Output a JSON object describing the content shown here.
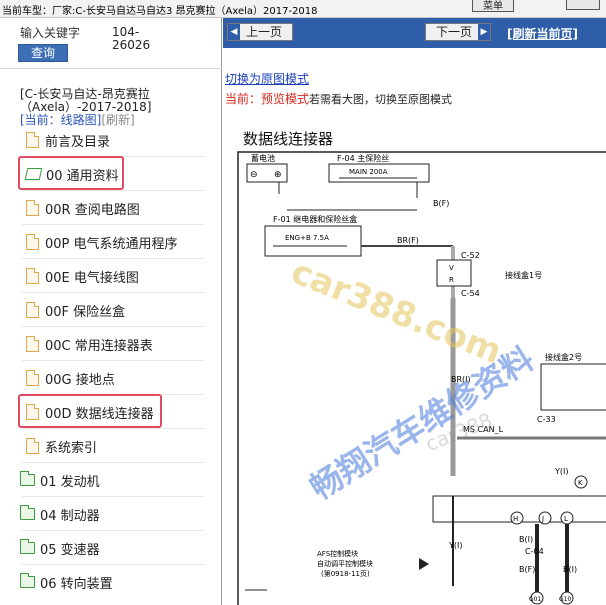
{
  "topbar": {
    "vehicle_label": "当前车型：",
    "vehicle_value": "厂家:C-长安马自达马自达3 昂克赛拉（Axela）2017-2018",
    "menu_label": "菜单"
  },
  "search": {
    "placeholder": "输入关键字",
    "button": "查询",
    "code_line1": "104-",
    "code_line2": "26026"
  },
  "car": {
    "line1": "[C-长安马自达-昂克赛拉",
    "line2": "（Axela）-2017-2018]",
    "current_label": "[当前：线路图]",
    "refresh_label": "[刷新]"
  },
  "tree": [
    {
      "label": "前言及目录",
      "icon": "file-icon"
    },
    {
      "label": "00 通用资料",
      "icon": "open-folder-icon"
    },
    {
      "label": "00R 查阅电路图",
      "icon": "file-icon"
    },
    {
      "label": "00P 电气系统通用程序",
      "icon": "file-icon"
    },
    {
      "label": "00E 电气接线图",
      "icon": "file-icon"
    },
    {
      "label": "00F 保险丝盒",
      "icon": "file-icon"
    },
    {
      "label": "00C 常用连接器表",
      "icon": "file-icon"
    },
    {
      "label": "00G 接地点",
      "icon": "file-icon"
    },
    {
      "label": "00D 数据线连接器",
      "icon": "file-icon"
    },
    {
      "label": "系统索引",
      "icon": "file-icon"
    },
    {
      "label": "01 发动机",
      "icon": "folder-icon"
    },
    {
      "label": "04 制动器",
      "icon": "folder-icon"
    },
    {
      "label": "05 变速器",
      "icon": "folder-icon"
    },
    {
      "label": "06 转向装置",
      "icon": "folder-icon"
    }
  ],
  "nav": {
    "prev": "上一页",
    "next": "下一页",
    "refresh": "[刷新当前页]"
  },
  "content": {
    "switch_link": "切换为原图模式",
    "mode_prefix": "当前：预览模式",
    "mode_suffix": "若需看大图，切换至原图模式",
    "section_title": "数据线连接器"
  },
  "diagram": {
    "battery": "蓄电池",
    "minus": "⊖",
    "plus": "⊕",
    "fuse_main_id": "F-04 主保险丝",
    "fuse_main_rating": "MAIN 200A",
    "wire_bf": "B(F)",
    "fuse_relay_id": "F-01 继电器和保险丝盒",
    "fuse_relay_rating": "ENG+B 7.5A",
    "wire_br_f": "BR(F)",
    "c52": "C-52",
    "v": "V",
    "r": "R",
    "c54": "C-54",
    "jbox1": "接线盒1号",
    "wire_br_i": "BR(I)",
    "jbox2": "接线盒2号",
    "c33": "C-33",
    "ms_can": "MS CAN_L",
    "y_i": "Y(I)",
    "pin_h": "H",
    "pin_j": "J",
    "pin_l": "L",
    "pin_k": "K",
    "b_i": "B(I)",
    "c04": "C-04",
    "afs1": "AFS控制模块",
    "afs2": "自动调平控制模块",
    "afs3": "(第0918-11页)",
    "g01": "G01",
    "g10": "G10"
  },
  "watermarks": {
    "site": "car388.com",
    "site_small": "car388",
    "brand": "畅翔汽车维修资料"
  },
  "colors": {
    "nav_blue": "#2f5ea8",
    "highlight_red": "#e24b5f",
    "link_blue": "#1a3fb8",
    "mode_red": "#d8261a"
  }
}
